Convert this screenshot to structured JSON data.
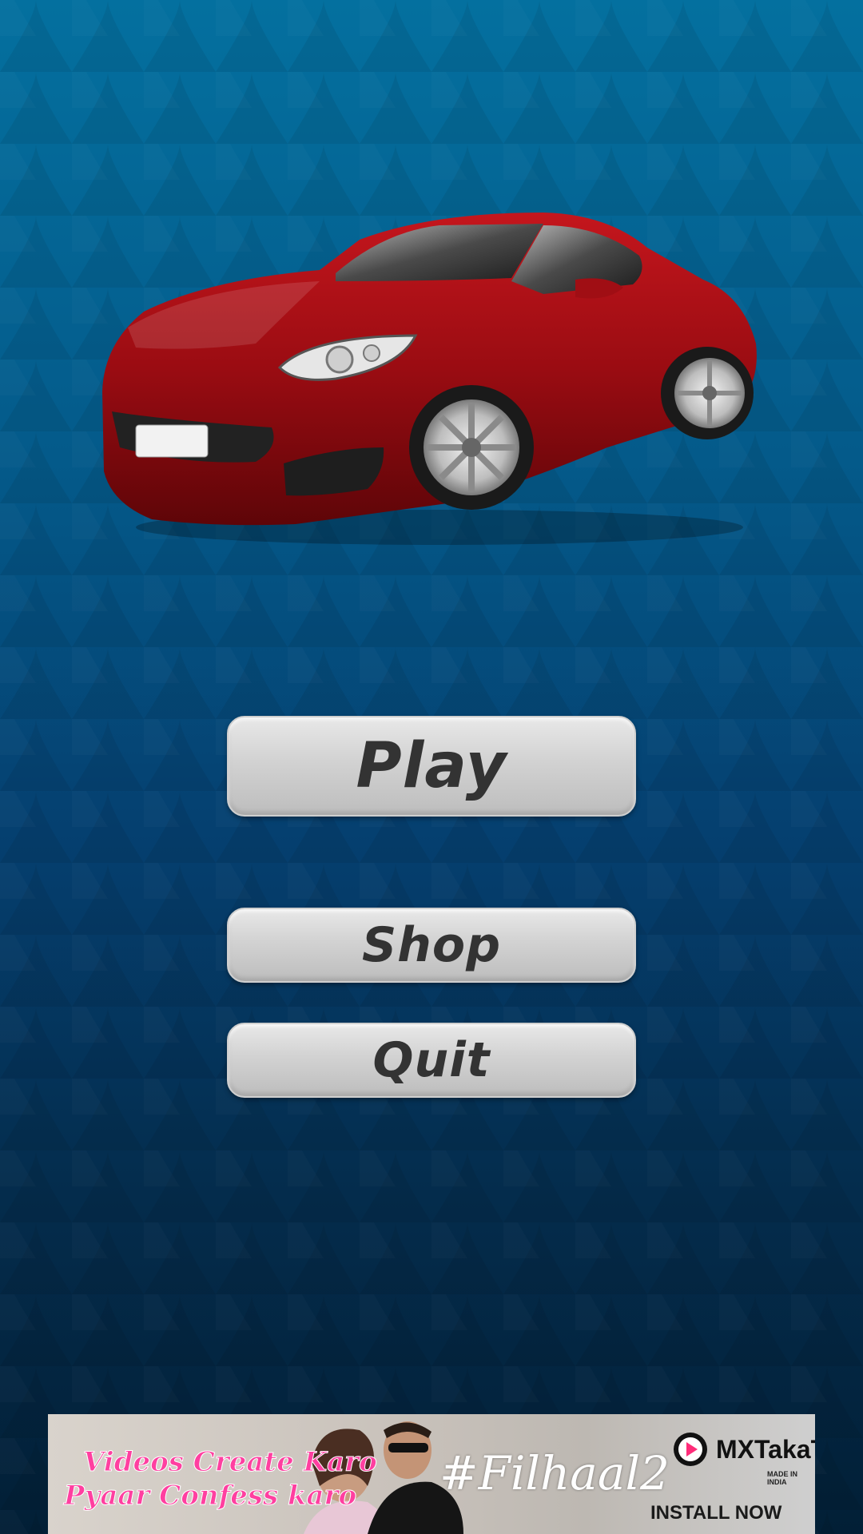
{
  "menu": {
    "play_label": "Play",
    "shop_label": "Shop",
    "quit_label": "Quit"
  },
  "ad": {
    "tagline_line1": "Videos Create Karo",
    "tagline_line2": "Pyaar Confess karo",
    "hashtag": "#Filhaal2",
    "brand": "MXTakaTak",
    "made_in": "MADE IN INDIA",
    "cta": "INSTALL NOW"
  },
  "icons": {
    "car": "red-sports-car-icon",
    "brand_logo": "play-circle-icon"
  },
  "colors": {
    "background_top": "#04709f",
    "background_bottom": "#021f36",
    "button_face": "#d2d2d2",
    "button_text": "#333333",
    "car_body": "#9a0c12",
    "ad_tagline": "#ff3fa0"
  }
}
